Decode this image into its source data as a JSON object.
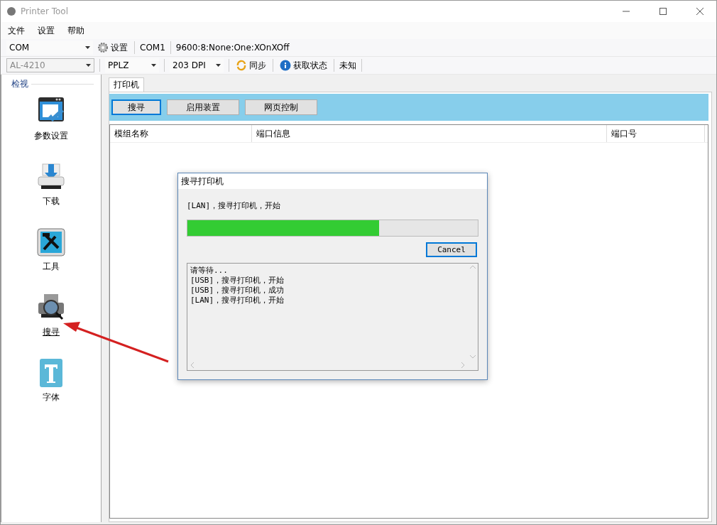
{
  "window": {
    "title": "Printer Tool"
  },
  "menu": [
    "文件",
    "设置",
    "帮助"
  ],
  "toolbar1": {
    "port": "COM",
    "settings": "设置",
    "port_name": "COM1",
    "params": "9600:8:None:One:XOnXOff"
  },
  "toolbar2": {
    "model": "AL-4210",
    "language": "PPLZ",
    "dpi": "203 DPI",
    "sync": "同步",
    "get_status": "获取状态",
    "status": "未知"
  },
  "sidebar": {
    "title": "检视",
    "items": [
      {
        "label": "参数设置",
        "kind": "settings",
        "selected": false
      },
      {
        "label": "下载",
        "kind": "download",
        "selected": false
      },
      {
        "label": "工具",
        "kind": "tools",
        "selected": false
      },
      {
        "label": "搜寻",
        "kind": "search",
        "selected": true
      },
      {
        "label": "字体",
        "kind": "font",
        "selected": false
      }
    ]
  },
  "tabs": [
    {
      "label": "打印机",
      "selected": true
    }
  ],
  "actions": [
    {
      "label": "搜寻",
      "selected": true
    },
    {
      "label": "启用装置",
      "selected": false
    },
    {
      "label": "网页控制",
      "selected": false
    }
  ],
  "table": {
    "columns": [
      "模组名称",
      "端口信息",
      "端口号"
    ]
  },
  "dialog": {
    "title": "搜寻打印机",
    "message": "[LAN]，搜寻打印机，开始",
    "level": 0.66,
    "cancel": "Cancel",
    "log": [
      "请等待...",
      "[USB]，搜寻打印机，开始",
      "[USB]，搜寻打印机，成功",
      "[LAN]，搜寻打印机，开始"
    ]
  }
}
